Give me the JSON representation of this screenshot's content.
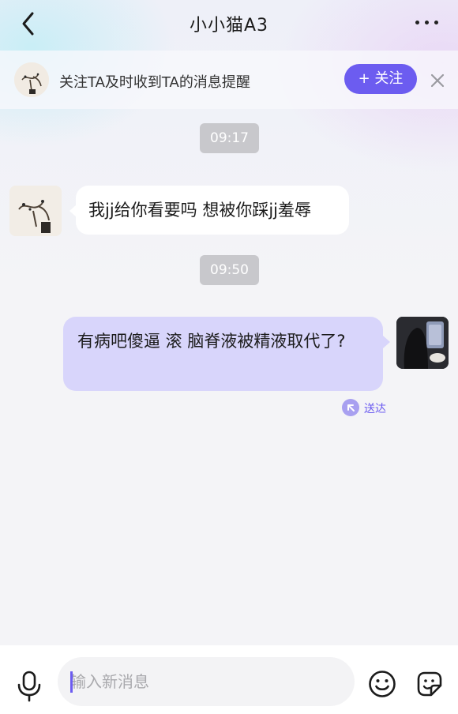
{
  "header": {
    "title": "小小猫A3",
    "back_icon": "chevron-left-icon",
    "more_icon": "more-horizontal-icon"
  },
  "follow_bar": {
    "text": "关注TA及时收到TA的消息提醒",
    "follow_label": "+ 关注",
    "close_icon": "close-icon"
  },
  "messages": [
    {
      "time": "09:17",
      "side": "left",
      "text": "我jj给你看要吗 想被你踩jj羞辱"
    },
    {
      "time": "09:50",
      "side": "right",
      "text": "有病吧傻逼 滚 脑脊液被精液取代了?",
      "status": "送达"
    }
  ],
  "input": {
    "placeholder": "输入新消息",
    "value": ""
  },
  "icons": {
    "voice": "microphone-icon",
    "emoji": "emoji-icon",
    "sticker": "sticker-icon"
  },
  "colors": {
    "accent": "#6c5cf0",
    "own_bubble": "#d8d5fb",
    "other_bubble": "#ffffff",
    "timestamp_bg": "#c8c8cc"
  }
}
